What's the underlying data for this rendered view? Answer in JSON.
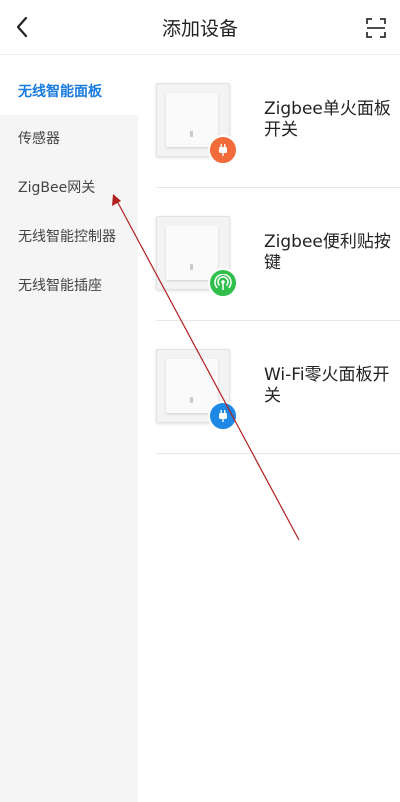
{
  "header": {
    "title": "添加设备",
    "back_icon": "chevron-left-icon",
    "scan_icon": "scan-icon"
  },
  "sidebar": {
    "items": [
      {
        "label": "无线智能面板",
        "active": true
      },
      {
        "label": "传感器",
        "active": false
      },
      {
        "label": "ZigBee网关",
        "active": false
      },
      {
        "label": "无线智能控制器",
        "active": false
      },
      {
        "label": "无线智能插座",
        "active": false
      }
    ]
  },
  "devices": [
    {
      "name": "Zigbee单火面板开关",
      "badge_icon": "plug-icon",
      "badge_color": "#f26b3a"
    },
    {
      "name": "Zigbee便利贴按键",
      "badge_icon": "wireless-signal-icon",
      "badge_color": "#2fbf4a"
    },
    {
      "name": "Wi-Fi零火面板开关",
      "badge_icon": "plug-icon",
      "badge_color": "#1e88e5"
    }
  ],
  "colors": {
    "accent": "#1a7bdf",
    "sidebar_bg": "#f5f5f5",
    "annotation_arrow": "#b0201e"
  }
}
